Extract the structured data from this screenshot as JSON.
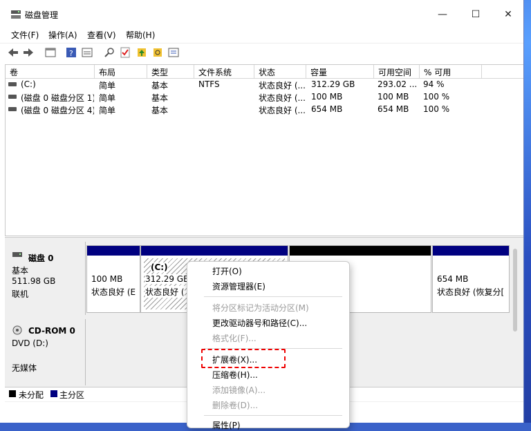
{
  "window": {
    "title": "磁盘管理",
    "controls": [
      "—",
      "☐",
      "✕"
    ]
  },
  "menu": [
    "文件(F)",
    "操作(A)",
    "查看(V)",
    "帮助(H)"
  ],
  "toolbar": [
    "back-icon",
    "forward-icon",
    "list-view-icon",
    "help-icon",
    "properties-icon",
    "connect-icon",
    "check-icon",
    "upload-icon",
    "search-icon",
    "settings-icon"
  ],
  "columns": [
    "卷",
    "布局",
    "类型",
    "文件系统",
    "状态",
    "容量",
    "可用空间",
    "% 可用"
  ],
  "volumes": [
    [
      "(C:)",
      "简单",
      "基本",
      "NTFS",
      "状态良好 (...",
      "312.29 GB",
      "293.02 ...",
      "94 %"
    ],
    [
      "(磁盘 0 磁盘分区 1)",
      "简单",
      "基本",
      "",
      "状态良好 (...",
      "100 MB",
      "100 MB",
      "100 %"
    ],
    [
      "(磁盘 0 磁盘分区 4)",
      "简单",
      "基本",
      "",
      "状态良好 (...",
      "654 MB",
      "654 MB",
      "100 %"
    ]
  ],
  "disk0": {
    "name": "磁盘 0",
    "type": "基本",
    "size": "511.98 GB",
    "status": "联机",
    "partitions": [
      {
        "line1": "100 MB",
        "line2": "状态良好 (E"
      },
      {
        "line0": "(C:)",
        "line1": "312.29 GB",
        "line2": "状态良好 ("
      },
      {
        "line1": "",
        "line2": ""
      },
      {
        "line1": "654 MB",
        "line2": "状态良好 (恢复分["
      }
    ]
  },
  "cdrom": {
    "name": "CD-ROM 0",
    "type": "DVD (D:)",
    "status": "无媒体"
  },
  "legend": {
    "unalloc": "未分配",
    "primary": "主分区",
    "unalloc_color": "#000000",
    "primary_color": "#000080"
  },
  "context_menu": [
    {
      "label": "打开(O)",
      "enabled": true
    },
    {
      "label": "资源管理器(E)",
      "enabled": true
    },
    {
      "label": "将分区标记为活动分区(M)",
      "enabled": false
    },
    {
      "label": "更改驱动器号和路径(C)...",
      "enabled": true
    },
    {
      "label": "格式化(F)...",
      "enabled": false
    },
    {
      "label": "扩展卷(X)...",
      "enabled": true,
      "highlighted": true
    },
    {
      "label": "压缩卷(H)...",
      "enabled": true
    },
    {
      "label": "添加镜像(A)...",
      "enabled": false
    },
    {
      "label": "删除卷(D)...",
      "enabled": false
    },
    {
      "label": "属性(P)",
      "enabled": true
    }
  ]
}
